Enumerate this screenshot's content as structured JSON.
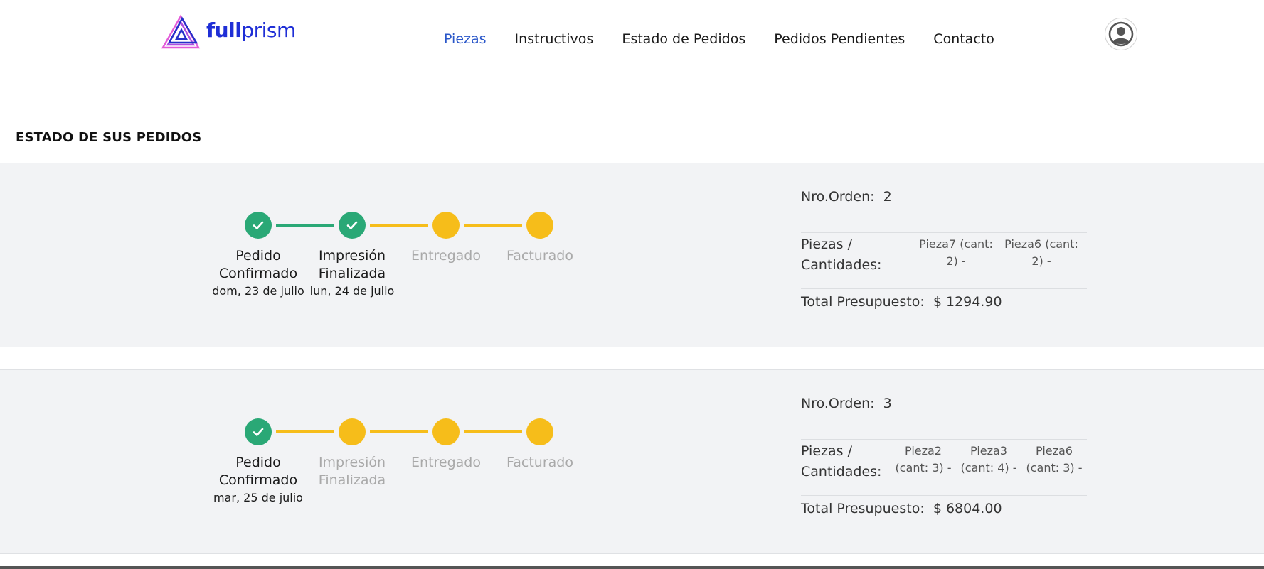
{
  "brand": {
    "full": "full",
    "prism": "prism"
  },
  "nav": {
    "items": [
      {
        "label": "Piezas",
        "active": true
      },
      {
        "label": "Instructivos",
        "active": false
      },
      {
        "label": "Estado de Pedidos",
        "active": false
      },
      {
        "label": "Pedidos Pendientes",
        "active": false
      },
      {
        "label": "Contacto",
        "active": false
      }
    ]
  },
  "page": {
    "title": "ESTADO DE SUS PEDIDOS"
  },
  "labels": {
    "order_number": "Nro.Orden:",
    "pieces": "Piezas / Cantidades:",
    "total": "Total Presupuesto:"
  },
  "orders": [
    {
      "number": "2",
      "steps": [
        {
          "label": "Pedido Confirmado",
          "date": "dom, 23 de julio",
          "status": "done"
        },
        {
          "label": "Impresión Finalizada",
          "date": "lun, 24 de julio",
          "status": "done"
        },
        {
          "label": "Entregado",
          "date": "",
          "status": "pending"
        },
        {
          "label": "Facturado",
          "date": "",
          "status": "pending"
        }
      ],
      "pieces": [
        "Pieza7 (cant: 2) -",
        "Pieza6 (cant: 2) -"
      ],
      "total": "$ 1294.90"
    },
    {
      "number": "3",
      "steps": [
        {
          "label": "Pedido Confirmado",
          "date": "mar, 25 de julio",
          "status": "done"
        },
        {
          "label": "Impresión Finalizada",
          "date": "",
          "status": "pending"
        },
        {
          "label": "Entregado",
          "date": "",
          "status": "pending"
        },
        {
          "label": "Facturado",
          "date": "",
          "status": "pending"
        }
      ],
      "pieces": [
        "Pieza2 (cant: 3) -",
        "Pieza3 (cant: 4) -",
        "Pieza6 (cant: 3) -"
      ],
      "total": "$ 6804.00"
    }
  ],
  "colors": {
    "done": "#2aa876",
    "pending": "#f6bd1a",
    "nav_active": "#2a57c9",
    "brand": "#1f2fd6"
  },
  "icons": {
    "step_done": "check-icon",
    "profile": "user-circle-icon",
    "logo": "prism-triangle-logo"
  }
}
